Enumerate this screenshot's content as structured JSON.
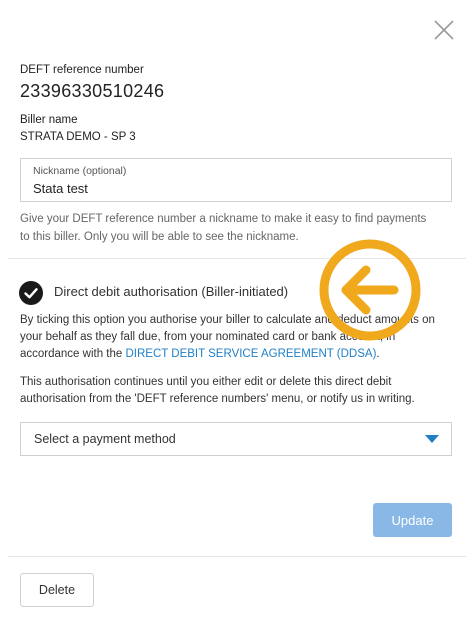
{
  "dialog": {
    "close_icon": "close-icon"
  },
  "reference": {
    "label": "DEFT reference number",
    "value": "23396330510246"
  },
  "biller": {
    "label": "Biller name",
    "value": "STRATA DEMO - SP 3"
  },
  "nickname": {
    "label": "Nickname (optional)",
    "value": "Stata test",
    "helper_line1": "Give your DEFT reference number a nickname to make it easy to find payments",
    "helper_line2": "to this biller. Only you will be able to see the nickname."
  },
  "direct_debit": {
    "checked": true,
    "check_icon": "checkmark-circle-icon",
    "title": "Direct debit authorisation (Biller-initiated)",
    "para1_line1": "By ticking this option you authorise your biller to calculate and deduct amounts on",
    "para1_line2": "your behalf as they fall due, from your nominated card or bank account, in",
    "para1_line3_prefix": "accordance with the ",
    "para1_link": "DIRECT DEBIT SERVICE AGREEMENT (DDSA)",
    "para1_suffix": ".",
    "para2_line1": "This authorisation continues until you either edit or delete this direct debit",
    "para2_line2": "authorisation from the 'DEFT reference numbers' menu, or notify us in writing."
  },
  "overlay": {
    "icon": "left-arrow-circle-icon",
    "color": "#f0a81c"
  },
  "payment_method": {
    "selected": "Select a payment method",
    "caret_icon": "caret-down-icon"
  },
  "actions": {
    "update_label": "Update",
    "delete_label": "Delete"
  },
  "colors": {
    "link": "#1f7fc7",
    "update_button": "#8ab8e6",
    "caret": "#1f7fc7"
  }
}
